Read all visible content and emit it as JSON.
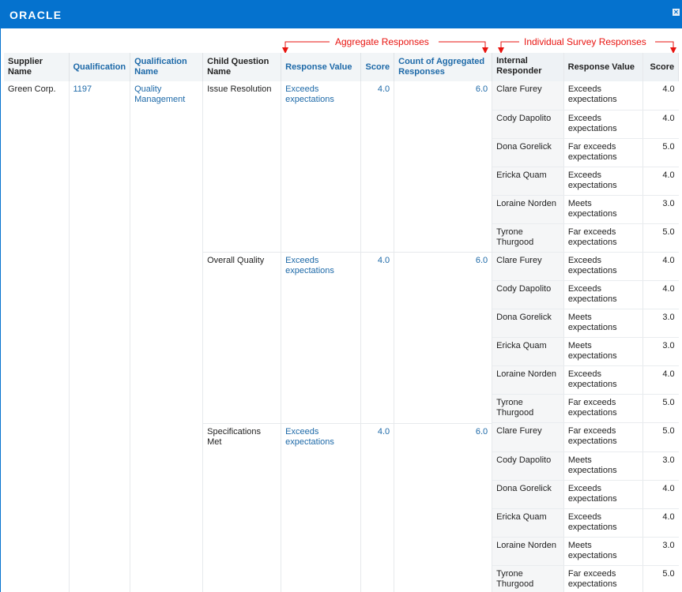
{
  "header": {
    "logo_text": "ORACLE",
    "close_label": "✕"
  },
  "annotations": {
    "aggregate": "Aggregate Responses",
    "individual": "Individual Survey Responses",
    "color": "#e8130f"
  },
  "columns": {
    "supplier_name": "Supplier Name",
    "qualification": "Qualification",
    "qualification_name": "Qualification Name",
    "child_question_name": "Child Question Name",
    "response_value": "Response Value",
    "score": "Score",
    "count_aggregated": "Count of Aggregated Responses",
    "internal_responder": "Internal Responder",
    "ind_response_value": "Response Value",
    "ind_score": "Score"
  },
  "row": {
    "supplier": "Green Corp.",
    "qualification": "1197",
    "qualification_name": "Quality Management"
  },
  "questions": [
    {
      "name": "Issue Resolution",
      "response": "Exceeds expectations",
      "score": "4.0",
      "count": "6.0",
      "responses": [
        {
          "responder": "Clare Furey",
          "value": "Exceeds expectations",
          "score": "4.0"
        },
        {
          "responder": "Cody Dapolito",
          "value": "Exceeds expectations",
          "score": "4.0"
        },
        {
          "responder": "Dona Gorelick",
          "value": "Far exceeds expectations",
          "score": "5.0"
        },
        {
          "responder": "Ericka Quam",
          "value": "Exceeds expectations",
          "score": "4.0"
        },
        {
          "responder": "Loraine Norden",
          "value": "Meets expectations",
          "score": "3.0"
        },
        {
          "responder": "Tyrone Thurgood",
          "value": "Far exceeds expectations",
          "score": "5.0"
        }
      ]
    },
    {
      "name": "Overall Quality",
      "response": "Exceeds expectations",
      "score": "4.0",
      "count": "6.0",
      "responses": [
        {
          "responder": "Clare Furey",
          "value": "Exceeds expectations",
          "score": "4.0"
        },
        {
          "responder": "Cody Dapolito",
          "value": "Exceeds expectations",
          "score": "4.0"
        },
        {
          "responder": "Dona Gorelick",
          "value": "Meets expectations",
          "score": "3.0"
        },
        {
          "responder": "Ericka Quam",
          "value": "Meets expectations",
          "score": "3.0"
        },
        {
          "responder": "Loraine Norden",
          "value": "Exceeds expectations",
          "score": "4.0"
        },
        {
          "responder": "Tyrone Thurgood",
          "value": "Far exceeds expectations",
          "score": "5.0"
        }
      ]
    },
    {
      "name": "Specifications Met",
      "response": "Exceeds expectations",
      "score": "4.0",
      "count": "6.0",
      "responses": [
        {
          "responder": "Clare Furey",
          "value": "Far exceeds expectations",
          "score": "5.0"
        },
        {
          "responder": "Cody Dapolito",
          "value": "Meets expectations",
          "score": "3.0"
        },
        {
          "responder": "Dona Gorelick",
          "value": "Exceeds expectations",
          "score": "4.0"
        },
        {
          "responder": "Ericka Quam",
          "value": "Exceeds expectations",
          "score": "4.0"
        },
        {
          "responder": "Loraine Norden",
          "value": "Meets expectations",
          "score": "3.0"
        },
        {
          "responder": "Tyrone Thurgood",
          "value": "Far exceeds expectations",
          "score": "5.0"
        }
      ]
    }
  ]
}
